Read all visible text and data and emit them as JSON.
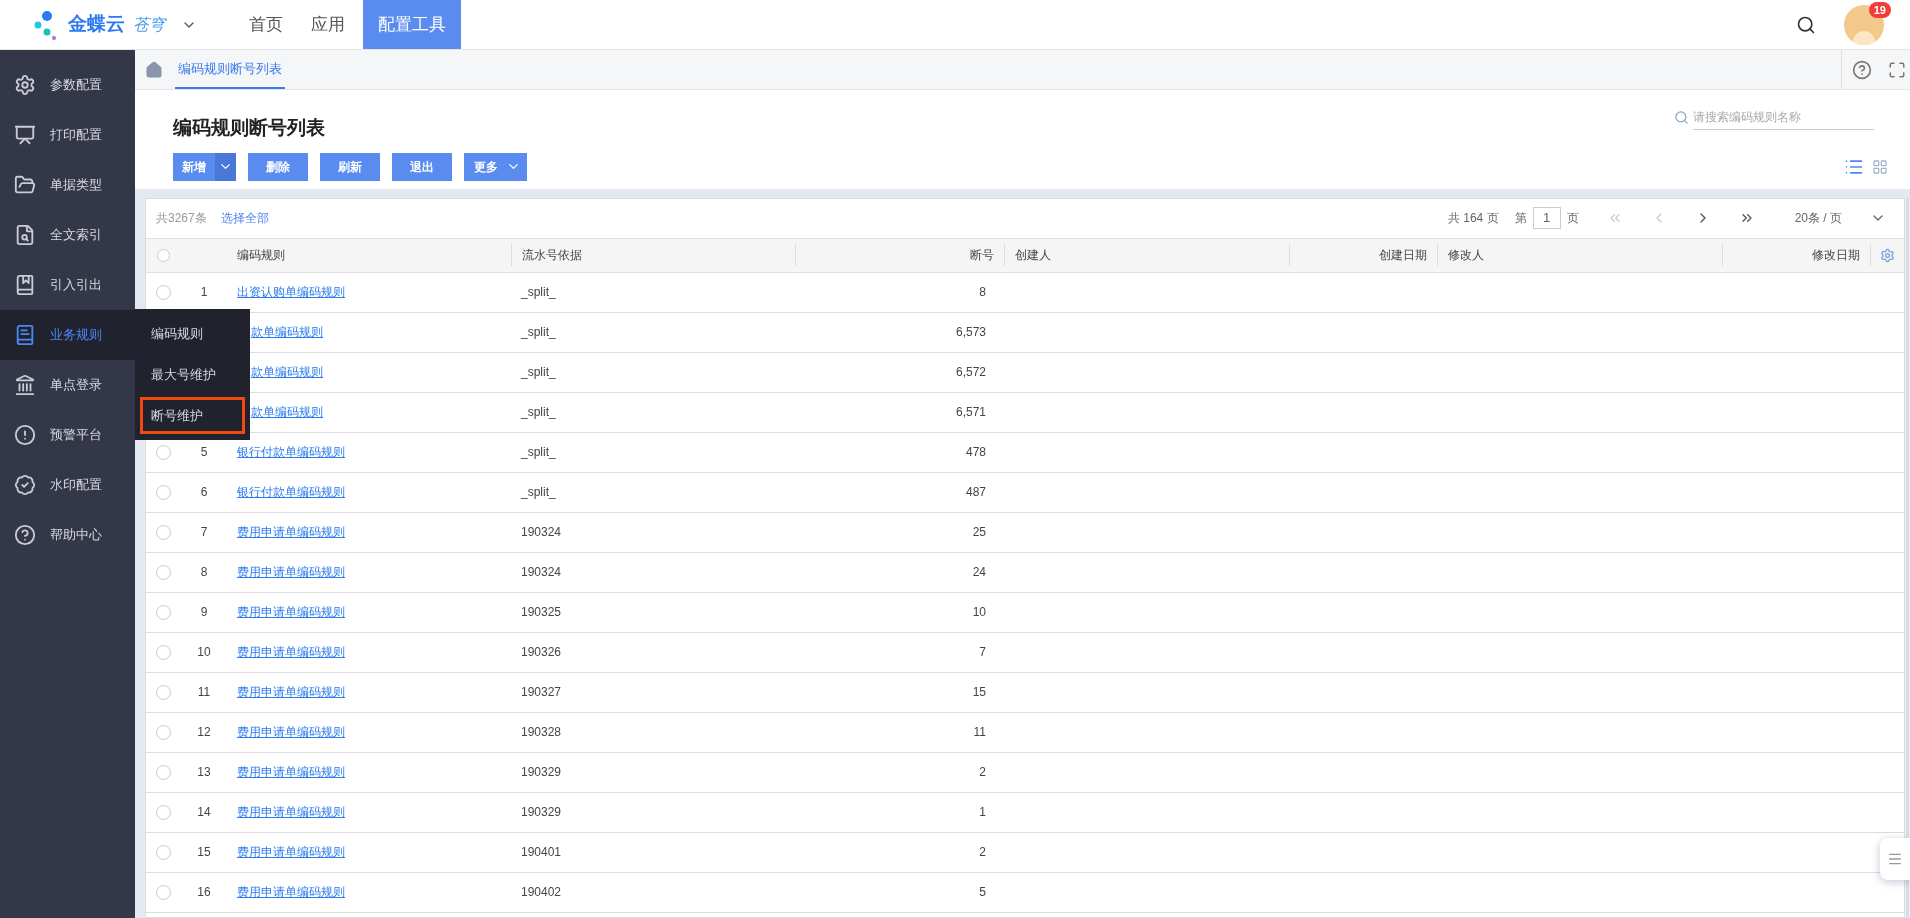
{
  "header": {
    "logo_text": "金蝶云",
    "logo_suffix": "苍穹",
    "nav": [
      {
        "label": "首页",
        "selected": false
      },
      {
        "label": "应用",
        "selected": false
      },
      {
        "label": "配置工具",
        "selected": true
      }
    ],
    "badge": "19"
  },
  "sidebar": {
    "items": [
      {
        "label": "参数配置",
        "kind": "gear",
        "selected": false
      },
      {
        "label": "打印配置",
        "kind": "print",
        "selected": false
      },
      {
        "label": "单据类型",
        "kind": "folder",
        "selected": false
      },
      {
        "label": "全文索引",
        "kind": "search",
        "selected": false
      },
      {
        "label": "引入引出",
        "kind": "book",
        "selected": false
      },
      {
        "label": "业务规则",
        "kind": "rules",
        "selected": true
      },
      {
        "label": "单点登录",
        "kind": "login",
        "selected": false
      },
      {
        "label": "预警平台",
        "kind": "alert",
        "selected": false
      },
      {
        "label": "水印配置",
        "kind": "watermark",
        "selected": false
      },
      {
        "label": "帮助中心",
        "kind": "help",
        "selected": false
      }
    ]
  },
  "flyout": {
    "items": [
      {
        "label": "编码规则",
        "selected": false
      },
      {
        "label": "最大号维护",
        "selected": false
      },
      {
        "label": "断号维护",
        "selected": true
      }
    ]
  },
  "tab": {
    "label": "编码规则断号列表"
  },
  "page_title": "编码规则断号列表",
  "search": {
    "placeholder": "请搜索编码规则名称"
  },
  "toolbar": {
    "buttons": [
      {
        "label": "新增",
        "kind": "split"
      },
      {
        "label": "删除",
        "kind": "plain"
      },
      {
        "label": "刷新",
        "kind": "plain"
      },
      {
        "label": "退出",
        "kind": "plain"
      },
      {
        "label": "更多",
        "kind": "dropdown"
      }
    ]
  },
  "table": {
    "total": "共3267条",
    "select_all": "选择全部",
    "all_selected": false,
    "pagination": {
      "total_pages": "共 164 页",
      "page_prefix": "第",
      "page": "1",
      "page_suffix": "页",
      "page_size": "20条 / 页"
    },
    "columns": [
      {
        "label": "编码规则"
      },
      {
        "label": "流水号依据"
      },
      {
        "label": "断号"
      },
      {
        "label": "创建人"
      },
      {
        "label": "创建日期"
      },
      {
        "label": "修改人"
      },
      {
        "label": "修改日期"
      }
    ],
    "rows": [
      {
        "index": "1",
        "name": "出资认购单编码规则",
        "basis": "_split_",
        "gap_no": "8",
        "selected": false
      },
      {
        "name": "款单编码规则",
        "basis": "_split_",
        "gap_no": "6,573"
      },
      {
        "name": "款单编码规则",
        "basis": "_split_",
        "gap_no": "6,572"
      },
      {
        "name": "款单编码规则",
        "basis": "_split_",
        "gap_no": "6,571"
      },
      {
        "index": "5",
        "name": "银行付款单编码规则",
        "basis": "_split_",
        "gap_no": "478",
        "selected": false
      },
      {
        "index": "6",
        "name": "银行付款单编码规则",
        "basis": "_split_",
        "gap_no": "487",
        "selected": false
      },
      {
        "index": "7",
        "name": "费用申请单编码规则",
        "basis": "190324",
        "gap_no": "25",
        "selected": false
      },
      {
        "index": "8",
        "name": "费用申请单编码规则",
        "basis": "190324",
        "gap_no": "24",
        "selected": false
      },
      {
        "index": "9",
        "name": "费用申请单编码规则",
        "basis": "190325",
        "gap_no": "10",
        "selected": false
      },
      {
        "index": "10",
        "name": "费用申请单编码规则",
        "basis": "190326",
        "gap_no": "7",
        "selected": false
      },
      {
        "index": "11",
        "name": "费用申请单编码规则",
        "basis": "190327",
        "gap_no": "15",
        "selected": false
      },
      {
        "index": "12",
        "name": "费用申请单编码规则",
        "basis": "190328",
        "gap_no": "11",
        "selected": false
      },
      {
        "index": "13",
        "name": "费用申请单编码规则",
        "basis": "190329",
        "gap_no": "2",
        "selected": false
      },
      {
        "index": "14",
        "name": "费用申请单编码规则",
        "basis": "190329",
        "gap_no": "1",
        "selected": false
      },
      {
        "index": "15",
        "name": "费用申请单编码规则",
        "basis": "190401",
        "gap_no": "2",
        "selected": false
      },
      {
        "index": "16",
        "name": "费用申请单编码规则",
        "basis": "190402",
        "gap_no": "5",
        "selected": false
      }
    ]
  }
}
